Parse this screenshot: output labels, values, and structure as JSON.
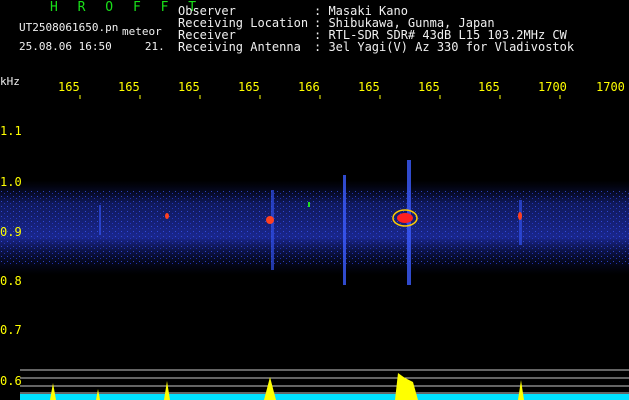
{
  "header": {
    "app_name": "H R O F F T",
    "file_name": "UT2508061650.pn",
    "file_suffix": "meteor",
    "timestamp": "25.08.06 16:50",
    "count": "21."
  },
  "metadata": [
    {
      "key": "Observer",
      "value": ": Masaki Kano"
    },
    {
      "key": "Receiving Location",
      "value": ": Shibukawa, Gunma, Japan"
    },
    {
      "key": "Receiver",
      "value": ": RTL-SDR SDR# 43dB L15 103.2MHz CW"
    },
    {
      "key": "Receiving Antenna",
      "value": ": 3el Yagi(V) Az 330 for Vladivostok"
    }
  ],
  "axis": {
    "unit": "kHz",
    "freq_labels": [
      "165",
      "165",
      "165",
      "165",
      "166",
      "165",
      "165",
      "165",
      "1700"
    ],
    "y_labels": [
      "1.1",
      "1.0",
      "0.9",
      "0.8",
      "0.7",
      "0.6"
    ]
  },
  "colors": {
    "background": "#000000",
    "header_green": "#19e019",
    "label_yellow": "#ffff00",
    "noise_blue": "#1a2a9a",
    "meteor_red": "#ff2020",
    "bar_yellow": "#ffff00",
    "bar_cyan": "#00e0ff"
  }
}
